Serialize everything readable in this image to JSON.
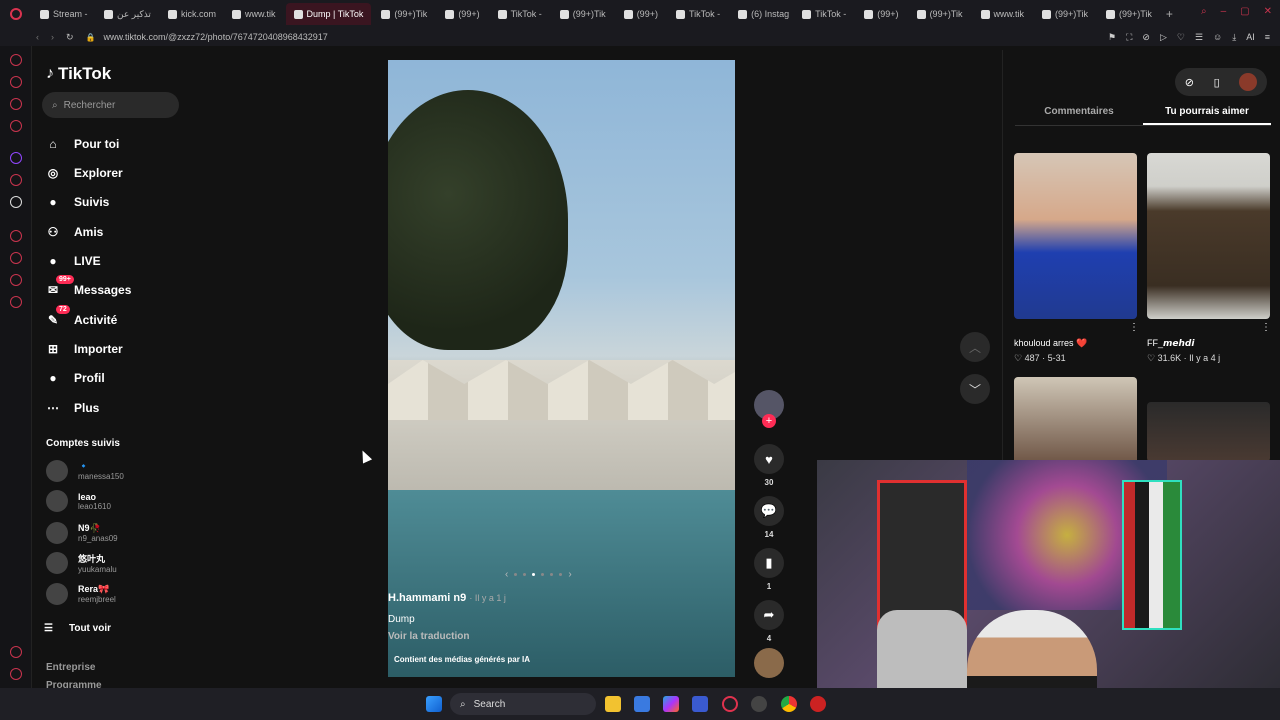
{
  "browser": {
    "tabs": [
      {
        "label": "Stream -"
      },
      {
        "label": "تذكير عن"
      },
      {
        "label": "kick.com"
      },
      {
        "label": "www.tik"
      },
      {
        "label": "Dump | TikTok",
        "active": true
      },
      {
        "label": "(99+)Tik"
      },
      {
        "label": "(99+)"
      },
      {
        "label": "TikTok -"
      },
      {
        "label": "(99+)Tik"
      },
      {
        "label": "(99+)"
      },
      {
        "label": "TikTok -"
      },
      {
        "label": "(6) Instag"
      },
      {
        "label": "TikTok -"
      },
      {
        "label": "(99+)"
      },
      {
        "label": "(99+)Tik"
      },
      {
        "label": "www.tik"
      },
      {
        "label": "(99+)Tik"
      },
      {
        "label": "(99+)Tik"
      }
    ],
    "url": "www.tiktok.com/@zxzz72/photo/7674720408968432917",
    "ai_label": "AI"
  },
  "sidebar": {
    "logo": "TikTok",
    "search_placeholder": "Rechercher",
    "nav": [
      {
        "label": "Pour toi",
        "icon": "home-icon"
      },
      {
        "label": "Explorer",
        "icon": "compass-icon"
      },
      {
        "label": "Suivis",
        "icon": "following-avatar-icon"
      },
      {
        "label": "Amis",
        "icon": "friends-icon"
      },
      {
        "label": "LIVE",
        "icon": "live-avatar-icon"
      },
      {
        "label": "Messages",
        "icon": "messages-icon",
        "badge": "99+"
      },
      {
        "label": "Activité",
        "icon": "activity-icon",
        "badge": "72"
      },
      {
        "label": "Importer",
        "icon": "upload-icon"
      },
      {
        "label": "Profil",
        "icon": "profile-avatar-icon"
      },
      {
        "label": "Plus",
        "icon": "more-icon"
      }
    ],
    "following_title": "Comptes suivis",
    "following": [
      {
        "name": "🔹",
        "handle": "manessa150"
      },
      {
        "name": "leao",
        "handle": "leao1610"
      },
      {
        "name": "N9🥀",
        "handle": "n9_anas09"
      },
      {
        "name": "悠叶丸",
        "handle": "yuukamalu"
      },
      {
        "name": "Rera🎀",
        "handle": "reemjbreel"
      }
    ],
    "see_all": "Tout voir",
    "footer": [
      "Entreprise",
      "Programme"
    ]
  },
  "post": {
    "author": "H.hammami n9",
    "time": "Il y a 1 j",
    "description": "Dump",
    "translate": "Voir la traduction",
    "ai_notice": "Contient des médias générés par IA",
    "likes": "30",
    "comments": "14",
    "saves": "1",
    "shares": "4",
    "slide_index": 3,
    "slide_count": 6
  },
  "right_panel": {
    "tabs": [
      "Commentaires",
      "Tu pourrais aimer"
    ],
    "active_tab": "Tu pourrais aimer",
    "recommendations": [
      {
        "user": "khouloud arres ❤️",
        "likes": "487",
        "date": "5-31"
      },
      {
        "user": "FF_𝙢𝙚𝙝𝙙𝙞",
        "likes": "31.6K",
        "date": "Il y a 4 j"
      }
    ]
  },
  "taskbar": {
    "search_label": "Search"
  },
  "colors": {
    "accent": "#fe2c55",
    "background": "#121212",
    "tab_active": "#3a1520"
  }
}
